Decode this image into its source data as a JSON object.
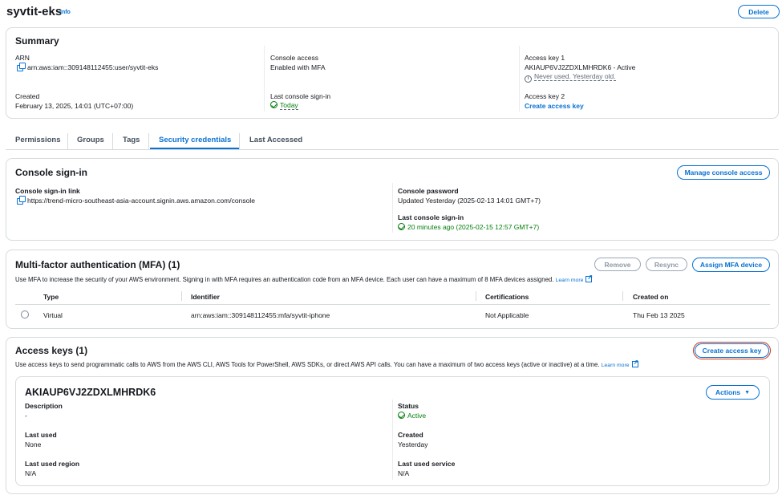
{
  "header": {
    "title": "syvtit-eks",
    "info": "Info",
    "delete": "Delete"
  },
  "summary": {
    "title": "Summary",
    "arn_label": "ARN",
    "arn_value": "arn:aws:iam::309148112455:user/syvtit-eks",
    "created_label": "Created",
    "created_value": "February 13, 2025, 14:01 (UTC+07:00)",
    "console_access_label": "Console access",
    "console_access_value": "Enabled with MFA",
    "last_signin_label": "Last console sign-in",
    "last_signin_value": "Today",
    "key1_label": "Access key 1",
    "key1_value": "AKIAUP6VJ2ZDXLMHRDK6 - Active",
    "key1_note": "Never used. Yesterday old.",
    "key2_label": "Access key 2",
    "key2_link": "Create access key"
  },
  "tabs": [
    "Permissions",
    "Groups",
    "Tags",
    "Security credentials",
    "Last Accessed"
  ],
  "console_signin": {
    "title": "Console sign-in",
    "manage_button": "Manage console access",
    "link_label": "Console sign-in link",
    "link_value": "https://trend-micro-southeast-asia-account.signin.aws.amazon.com/console",
    "password_label": "Console password",
    "password_value": "Updated Yesterday (2025-02-13 14:01 GMT+7)",
    "last_signin_label": "Last console sign-in",
    "last_signin_value": "20 minutes ago (2025-02-15 12:57 GMT+7)"
  },
  "mfa": {
    "title": "Multi-factor authentication (MFA) (1)",
    "remove": "Remove",
    "resync": "Resync",
    "assign": "Assign MFA device",
    "description": "Use MFA to increase the security of your AWS environment. Signing in with MFA requires an authentication code from an MFA device. Each user can have a maximum of 8 MFA devices assigned.",
    "learn_more": "Learn more",
    "columns": [
      "Type",
      "Identifier",
      "Certifications",
      "Created on"
    ],
    "rows": [
      [
        "Virtual",
        "arn:aws:iam::309148112455:mfa/syvtit-iphone",
        "Not Applicable",
        "Thu Feb 13 2025"
      ]
    ]
  },
  "access_keys": {
    "title": "Access keys (1)",
    "create_button": "Create access key",
    "description": "Use access keys to send programmatic calls to AWS from the AWS CLI, AWS Tools for PowerShell, AWS SDKs, or direct AWS API calls. You can have a maximum of two access keys (active or inactive) at a time.",
    "learn_more": "Learn more",
    "key": {
      "id": "AKIAUP6VJ2ZDXLMHRDK6",
      "actions": "Actions",
      "description_label": "Description",
      "description_value": "-",
      "status_label": "Status",
      "status_value": "Active",
      "last_used_label": "Last used",
      "last_used_value": "None",
      "created_label": "Created",
      "created_value": "Yesterday",
      "region_label": "Last used region",
      "region_value": "N/A",
      "service_label": "Last used service",
      "service_value": "N/A"
    }
  }
}
